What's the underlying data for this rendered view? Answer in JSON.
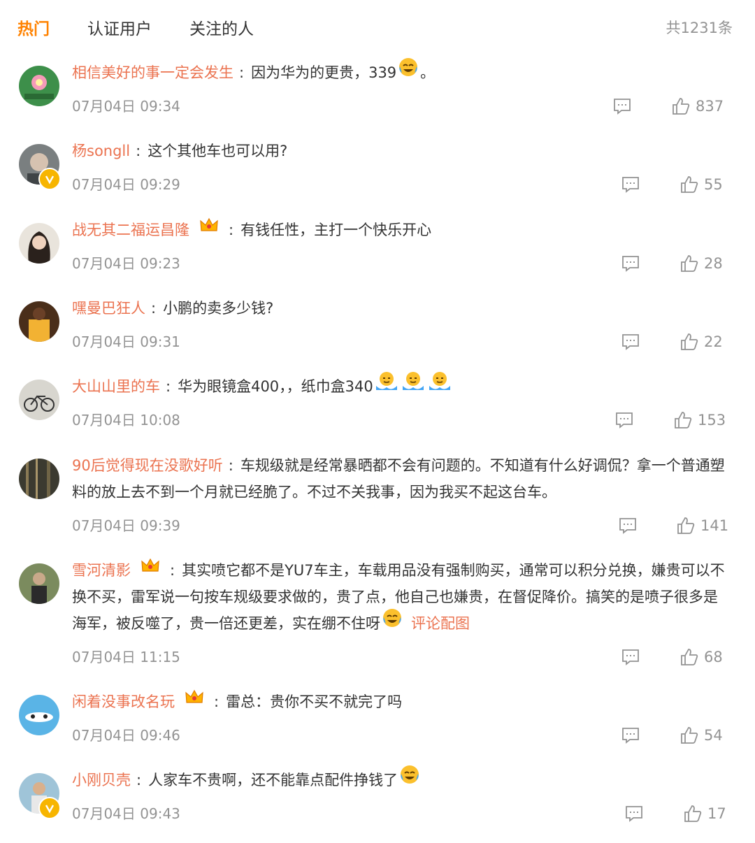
{
  "tabs": {
    "hot": "热门",
    "verified": "认证用户",
    "following": "关注的人"
  },
  "total_count": "共1231条",
  "colors": {
    "accent": "#ff8200",
    "username": "#eb7350",
    "meta": "#939393",
    "verified_badge": "#f7b500"
  },
  "comments": [
    {
      "user": "相信美好的事一定会发生",
      "text_before": "因为华为的更贵，339",
      "text_after": "。",
      "emoji": "laugh-cry-icon",
      "time": "07月04日 09:34",
      "likes": "837"
    },
    {
      "user": "杨songll",
      "text": "这个其他车也可以用?",
      "verified": true,
      "time": "07月04日 09:29",
      "likes": "55"
    },
    {
      "user": "战无其二福运昌隆",
      "text": "有钱任性，主打一个快乐开心",
      "crown": true,
      "time": "07月04日 09:23",
      "likes": "28"
    },
    {
      "user": "嘿曼巴狂人",
      "text": "小鹏的卖多少钱?",
      "time": "07月04日 09:31",
      "likes": "22"
    },
    {
      "user": "大山山里的车",
      "text": "华为眼镜盒400，，纸巾盒340",
      "emoji": "shrug-icon",
      "time": "07月04日 10:08",
      "likes": "153"
    },
    {
      "user": "90后觉得现在没歌好听",
      "text": "车规级就是经常暴晒都不会有问题的。不知道有什么好调侃？拿一个普通塑料的放上去不到一个月就已经脆了。不过不关我事，因为我买不起这台车。",
      "time": "07月04日 09:39",
      "likes": "141"
    },
    {
      "user": "雪河清影",
      "text": "其实喷它都不是YU7车主，车载用品没有强制购买，通常可以积分兑换，嫌贵可以不换不买，雷军说一句按车规级要求做的，贵了点，他自己也嫌贵，在督促降价。搞笑的是喷子很多是海军，被反噬了，贵一倍还更差，实在绷不住呀",
      "crown": true,
      "link": "评论配图",
      "emoji": "laugh-cry-icon",
      "time": "07月04日 11:15",
      "likes": "68"
    },
    {
      "user": "闲着没事改名玩",
      "text": "雷总：贵你不买不就完了吗",
      "crown": true,
      "time": "07月04日 09:46",
      "likes": "54"
    },
    {
      "user": "小刚贝壳",
      "text": "人家车不贵啊，还不能靠点配件挣钱了",
      "verified": true,
      "emoji": "laugh-cry-icon",
      "time": "07月04日 09:43",
      "likes": "17"
    }
  ]
}
